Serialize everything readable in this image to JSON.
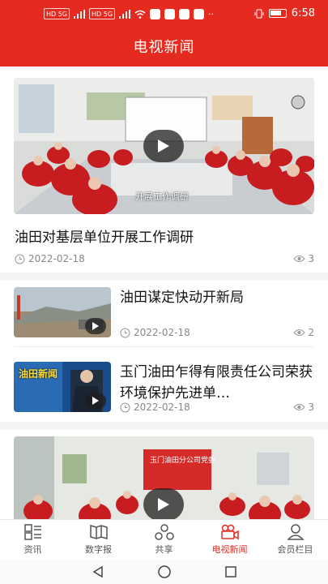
{
  "status_bar": {
    "sim1": "HD 5G",
    "sim2": "HD 5G",
    "time": "6:58"
  },
  "header": {
    "title": "电视新闻"
  },
  "news": [
    {
      "title": "油田对基层单位开展工作调研",
      "date": "2022-02-18",
      "views": "3",
      "thumb_caption": "开展工作调研"
    },
    {
      "title": "油田谋定快动开新局",
      "date": "2022-02-18",
      "views": "2"
    },
    {
      "title": "玉门油田乍得有限责任公司荣获环境保护先进单…",
      "date": "2022-02-18",
      "views": "3",
      "thumb_caption": "油田新闻"
    },
    {
      "title": "",
      "thumb_caption": "玉门油田分公司党委"
    }
  ],
  "tabs": [
    {
      "label": "资讯",
      "icon": "news-grid-icon"
    },
    {
      "label": "数字报",
      "icon": "newspaper-icon"
    },
    {
      "label": "共享",
      "icon": "share-icon"
    },
    {
      "label": "电视新闻",
      "icon": "video-camera-icon"
    },
    {
      "label": "会员栏目",
      "icon": "user-icon"
    }
  ],
  "colors": {
    "brand": "#e52b20",
    "muted": "#888888"
  }
}
